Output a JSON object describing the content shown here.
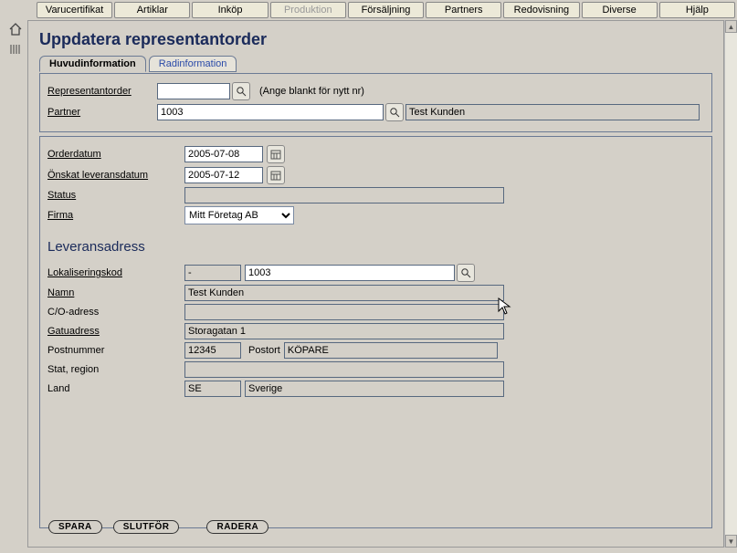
{
  "menu": {
    "items": [
      "Varucertifikat",
      "Artiklar",
      "Inköp",
      "Produktion",
      "Försäljning",
      "Partners",
      "Redovisning",
      "Diverse",
      "Hjälp"
    ],
    "disabled_index": 3
  },
  "page": {
    "title": "Uppdatera representantorder"
  },
  "tabs": {
    "main": "Huvudinformation",
    "lines": "Radinformation"
  },
  "topPanel": {
    "repOrderLabel": "Representantorder",
    "repOrderValue": "",
    "repOrderHint": "(Ange blankt för nytt nr)",
    "partnerLabel": "Partner",
    "partnerCode": "1003",
    "partnerName": "Test Kunden"
  },
  "orderPanel": {
    "orderDateLabel": "Orderdatum",
    "orderDateValue": "2005-07-08",
    "reqDateLabel": "Önskat leveransdatum",
    "reqDateValue": "2005-07-12",
    "statusLabel": "Status",
    "statusValue": "",
    "firmaLabel": "Firma",
    "firmaValue": "Mitt Företag AB"
  },
  "delivery": {
    "heading": "Leveransadress",
    "locLabel": "Lokaliseringskod",
    "locPrefix": "-",
    "locCode": "1003",
    "nameLabel": "Namn",
    "nameValue": "Test Kunden",
    "coLabel": "C/O-adress",
    "coValue": "",
    "streetLabel": "Gatuadress",
    "streetValue": "Storagatan 1",
    "postNrLabel": "Postnummer",
    "postNrValue": "12345",
    "postOrtLabel": "Postort",
    "postOrtValue": "KÖPARE",
    "stateLabel": "Stat, region",
    "stateValue": "",
    "landLabel": "Land",
    "landCode": "SE",
    "landName": "Sverige"
  },
  "buttons": {
    "save": "SPARA",
    "finish": "SLUTFÖR",
    "delete": "RADERA"
  },
  "colors": {
    "heading": "#1a2a5a",
    "link": "#2a4aa8"
  }
}
